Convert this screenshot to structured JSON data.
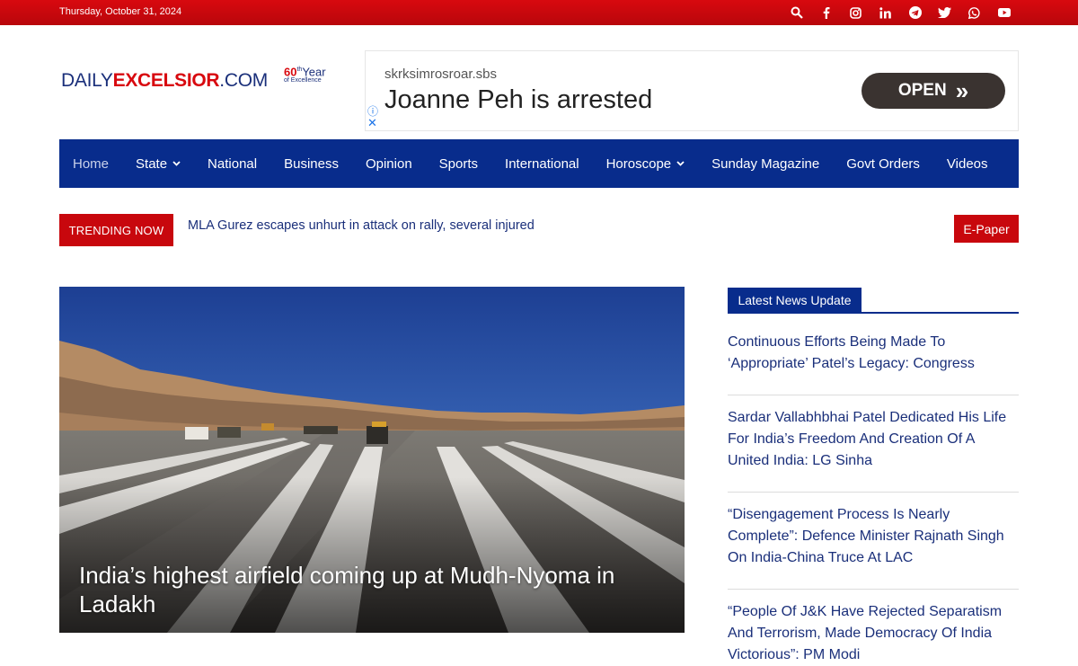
{
  "topbar": {
    "date": "Thursday, October 31, 2024",
    "social_icons": [
      "search-icon",
      "facebook-icon",
      "instagram-icon",
      "linkedin-icon",
      "telegram-icon",
      "twitter-icon",
      "whatsapp-icon",
      "youtube-icon"
    ],
    "background_color": "#c8070d"
  },
  "logo": {
    "part1": "DAILY",
    "part2": "EXCELSIOR",
    "part3": ".COM",
    "badge_number": "60",
    "badge_suffix": "th",
    "badge_word": "Year",
    "badge_tagline": "of Excellence"
  },
  "ad": {
    "site": "skrksimrosroar.sbs",
    "headline": "Joanne Peh is arrested",
    "cta": "OPEN",
    "cta_arrows": "»"
  },
  "nav": {
    "items": [
      {
        "label": "Home",
        "dropdown": false
      },
      {
        "label": "State",
        "dropdown": true
      },
      {
        "label": "National",
        "dropdown": false
      },
      {
        "label": "Business",
        "dropdown": false
      },
      {
        "label": "Opinion",
        "dropdown": false
      },
      {
        "label": "Sports",
        "dropdown": false
      },
      {
        "label": "International",
        "dropdown": false
      },
      {
        "label": "Horoscope",
        "dropdown": true
      },
      {
        "label": "Sunday Magazine",
        "dropdown": false
      },
      {
        "label": "Govt Orders",
        "dropdown": false
      },
      {
        "label": "Videos",
        "dropdown": false
      }
    ],
    "background_color": "#082c8c"
  },
  "trending": {
    "badge": "TRENDING NOW",
    "headline": "MLA Gurez escapes unhurt in attack on rally, several injured",
    "epaper": "E-Paper"
  },
  "hero": {
    "caption": "India’s highest airfield coming up at Mudh-Nyoma in Ladakh"
  },
  "sidebar": {
    "title": "Latest News Update",
    "news": [
      "Continuous Efforts Being Made To ‘Appropriate’ Patel’s Legacy: Congress",
      "Sardar Vallabhbhai Patel Dedicated His Life For India’s Freedom And Creation Of A United India: LG Sinha",
      "“Disengagement Process Is Nearly Complete”: Defence Minister Rajnath Singh On India-China Truce At LAC",
      "“People Of J&K Have Rejected Separatism And Terrorism, Made Democracy Of India Victorious”: PM Modi"
    ]
  }
}
